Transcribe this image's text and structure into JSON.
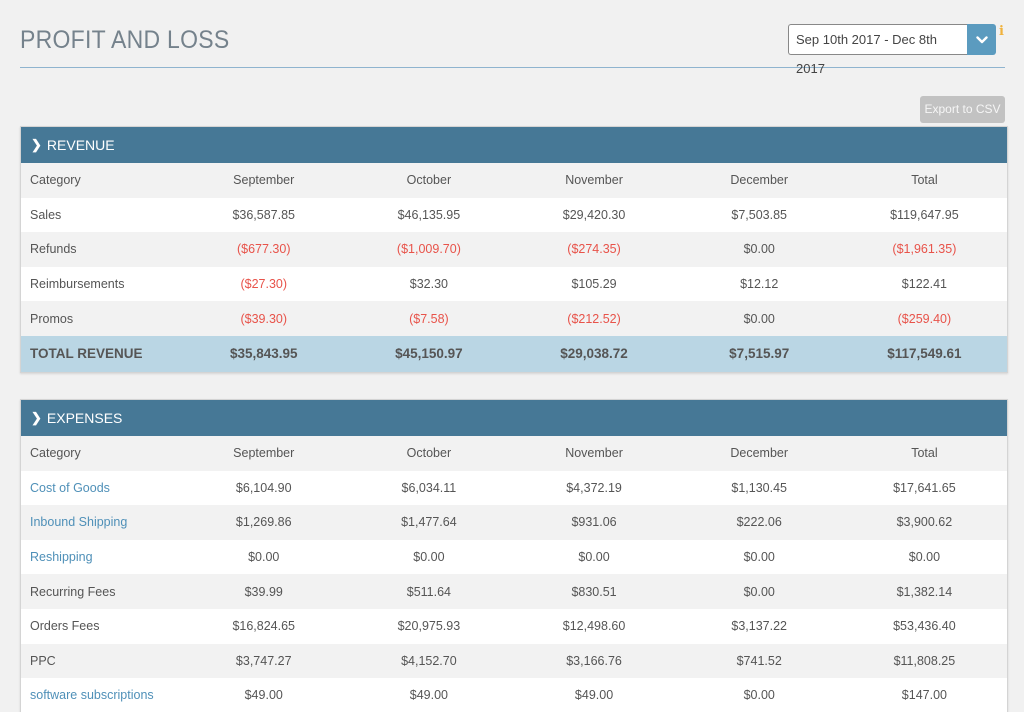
{
  "header": {
    "title": "PROFIT AND LOSS",
    "date_range": "Sep 10th 2017 - Dec 8th 2017",
    "info_icon": "i",
    "export_label": "Export to CSV"
  },
  "colors": {
    "panel_header": "#467896",
    "total_row": "#bad6e4",
    "negative": "#e8534a",
    "link": "#4f90b8",
    "info": "#f0b23d",
    "dropdown_button": "#5b9bbf"
  },
  "revenue": {
    "title": "REVENUE",
    "columns": [
      "Category",
      "September",
      "October",
      "November",
      "December",
      "Total"
    ],
    "rows": [
      {
        "label": "Sales",
        "values": [
          "$36,587.85",
          "$46,135.95",
          "$29,420.30",
          "$7,503.85",
          "$119,647.95"
        ],
        "neg": [
          false,
          false,
          false,
          false,
          false
        ]
      },
      {
        "label": "Refunds",
        "values": [
          "($677.30)",
          "($1,009.70)",
          "($274.35)",
          "$0.00",
          "($1,961.35)"
        ],
        "neg": [
          true,
          true,
          true,
          false,
          true
        ]
      },
      {
        "label": "Reimbursements",
        "values": [
          "($27.30)",
          "$32.30",
          "$105.29",
          "$12.12",
          "$122.41"
        ],
        "neg": [
          true,
          false,
          false,
          false,
          false
        ]
      },
      {
        "label": "Promos",
        "values": [
          "($39.30)",
          "($7.58)",
          "($212.52)",
          "$0.00",
          "($259.40)"
        ],
        "neg": [
          true,
          true,
          true,
          false,
          true
        ]
      }
    ],
    "total": {
      "label": "TOTAL REVENUE",
      "values": [
        "$35,843.95",
        "$45,150.97",
        "$29,038.72",
        "$7,515.97",
        "$117,549.61"
      ]
    }
  },
  "expenses": {
    "title": "EXPENSES",
    "columns": [
      "Category",
      "September",
      "October",
      "November",
      "December",
      "Total"
    ],
    "rows": [
      {
        "label": "Cost of Goods",
        "link": true,
        "values": [
          "$6,104.90",
          "$6,034.11",
          "$4,372.19",
          "$1,130.45",
          "$17,641.65"
        ]
      },
      {
        "label": "Inbound Shipping",
        "link": true,
        "values": [
          "$1,269.86",
          "$1,477.64",
          "$931.06",
          "$222.06",
          "$3,900.62"
        ]
      },
      {
        "label": "Reshipping",
        "link": true,
        "values": [
          "$0.00",
          "$0.00",
          "$0.00",
          "$0.00",
          "$0.00"
        ]
      },
      {
        "label": "Recurring Fees",
        "link": false,
        "values": [
          "$39.99",
          "$511.64",
          "$830.51",
          "$0.00",
          "$1,382.14"
        ]
      },
      {
        "label": "Orders Fees",
        "link": false,
        "values": [
          "$16,824.65",
          "$20,975.93",
          "$12,498.60",
          "$3,137.22",
          "$53,436.40"
        ]
      },
      {
        "label": "PPC",
        "link": false,
        "values": [
          "$3,747.27",
          "$4,152.70",
          "$3,166.76",
          "$741.52",
          "$11,808.25"
        ]
      },
      {
        "label": "software subscriptions",
        "link": true,
        "values": [
          "$49.00",
          "$49.00",
          "$49.00",
          "$0.00",
          "$147.00"
        ]
      }
    ]
  }
}
